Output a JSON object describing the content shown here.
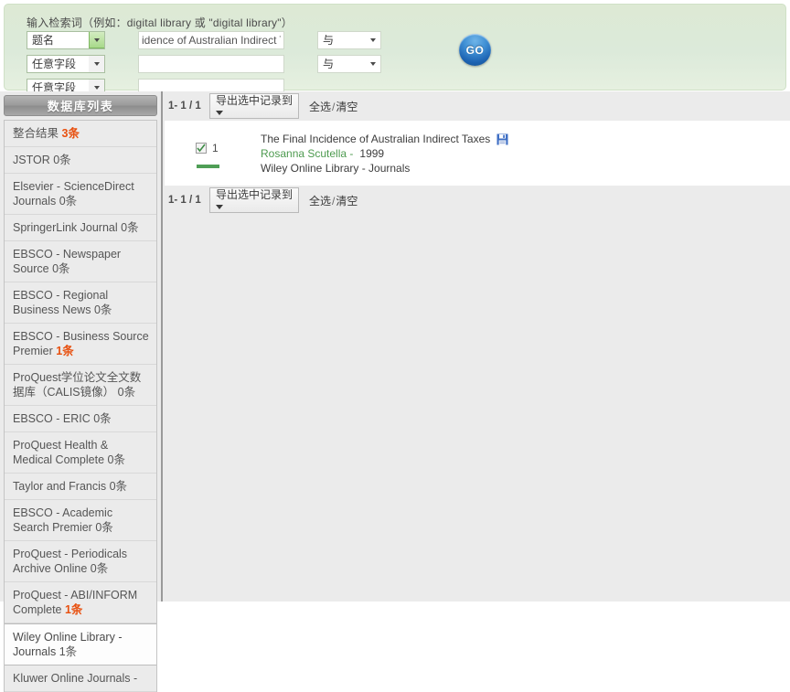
{
  "search": {
    "hint": "输入检索词（例如：digital library 或 \"digital library\"）",
    "rows": [
      {
        "field": "题名",
        "term": "idence of Australian Indirect Taxes",
        "operator": "与",
        "has_operator": true,
        "focused": true
      },
      {
        "field": "任意字段",
        "term": "",
        "operator": "与",
        "has_operator": true,
        "focused": false
      },
      {
        "field": "任意字段",
        "term": "",
        "operator": "",
        "has_operator": false,
        "focused": false
      }
    ],
    "go_label": "GO"
  },
  "sidebar": {
    "header": "数据库列表",
    "items": [
      {
        "name": "整合结果",
        "count": "3条",
        "hot": true,
        "selected": false
      },
      {
        "name": "JSTOR",
        "count": "0条",
        "hot": false,
        "selected": false
      },
      {
        "name": "Elsevier - ScienceDirect Journals",
        "count": "0条",
        "hot": false,
        "selected": false
      },
      {
        "name": "SpringerLink Journal",
        "count": "0条",
        "hot": false,
        "selected": false
      },
      {
        "name": "EBSCO - Newspaper Source",
        "count": "0条",
        "hot": false,
        "selected": false
      },
      {
        "name": "EBSCO - Regional Business News",
        "count": "0条",
        "hot": false,
        "selected": false
      },
      {
        "name": "EBSCO - Business Source Premier",
        "count": "1条",
        "hot": true,
        "selected": false
      },
      {
        "name": "ProQuest学位论文全文数据库（CALIS镜像）",
        "count": "0条",
        "hot": false,
        "selected": false
      },
      {
        "name": "EBSCO - ERIC",
        "count": "0条",
        "hot": false,
        "selected": false
      },
      {
        "name": "ProQuest Health & Medical Complete",
        "count": "0条",
        "hot": false,
        "selected": false
      },
      {
        "name": "Taylor and Francis",
        "count": "0条",
        "hot": false,
        "selected": false
      },
      {
        "name": "EBSCO - Academic Search Premier",
        "count": "0条",
        "hot": false,
        "selected": false
      },
      {
        "name": "ProQuest - Periodicals Archive Online",
        "count": "0条",
        "hot": false,
        "selected": false
      },
      {
        "name": "ProQuest - ABI/INFORM Complete",
        "count": "1条",
        "hot": true,
        "selected": false
      },
      {
        "name": "Wiley Online Library - Journals",
        "count": "1条",
        "hot": false,
        "selected": true
      },
      {
        "name": "Kluwer Online Journals -",
        "count": "",
        "hot": false,
        "selected": false
      }
    ]
  },
  "toolbar": {
    "pager": "1- 1 / 1",
    "export_label": "导出选中记录到",
    "select_all": "全选",
    "separator": "/",
    "clear": "清空"
  },
  "results": [
    {
      "index": "1",
      "checked": true,
      "title": "The Final Incidence of Australian Indirect Taxes",
      "author": "Rosanna Scutella -",
      "year": "1999",
      "source": "Wiley Online Library - Journals",
      "save_icon": "floppy-save-icon"
    }
  ],
  "colors": {
    "accent_green": "#4f9e56",
    "hot_orange": "#e8500f",
    "go_blue": "#1d63b2",
    "panel_green": "#dceada",
    "body_gray": "#ebebeb"
  }
}
